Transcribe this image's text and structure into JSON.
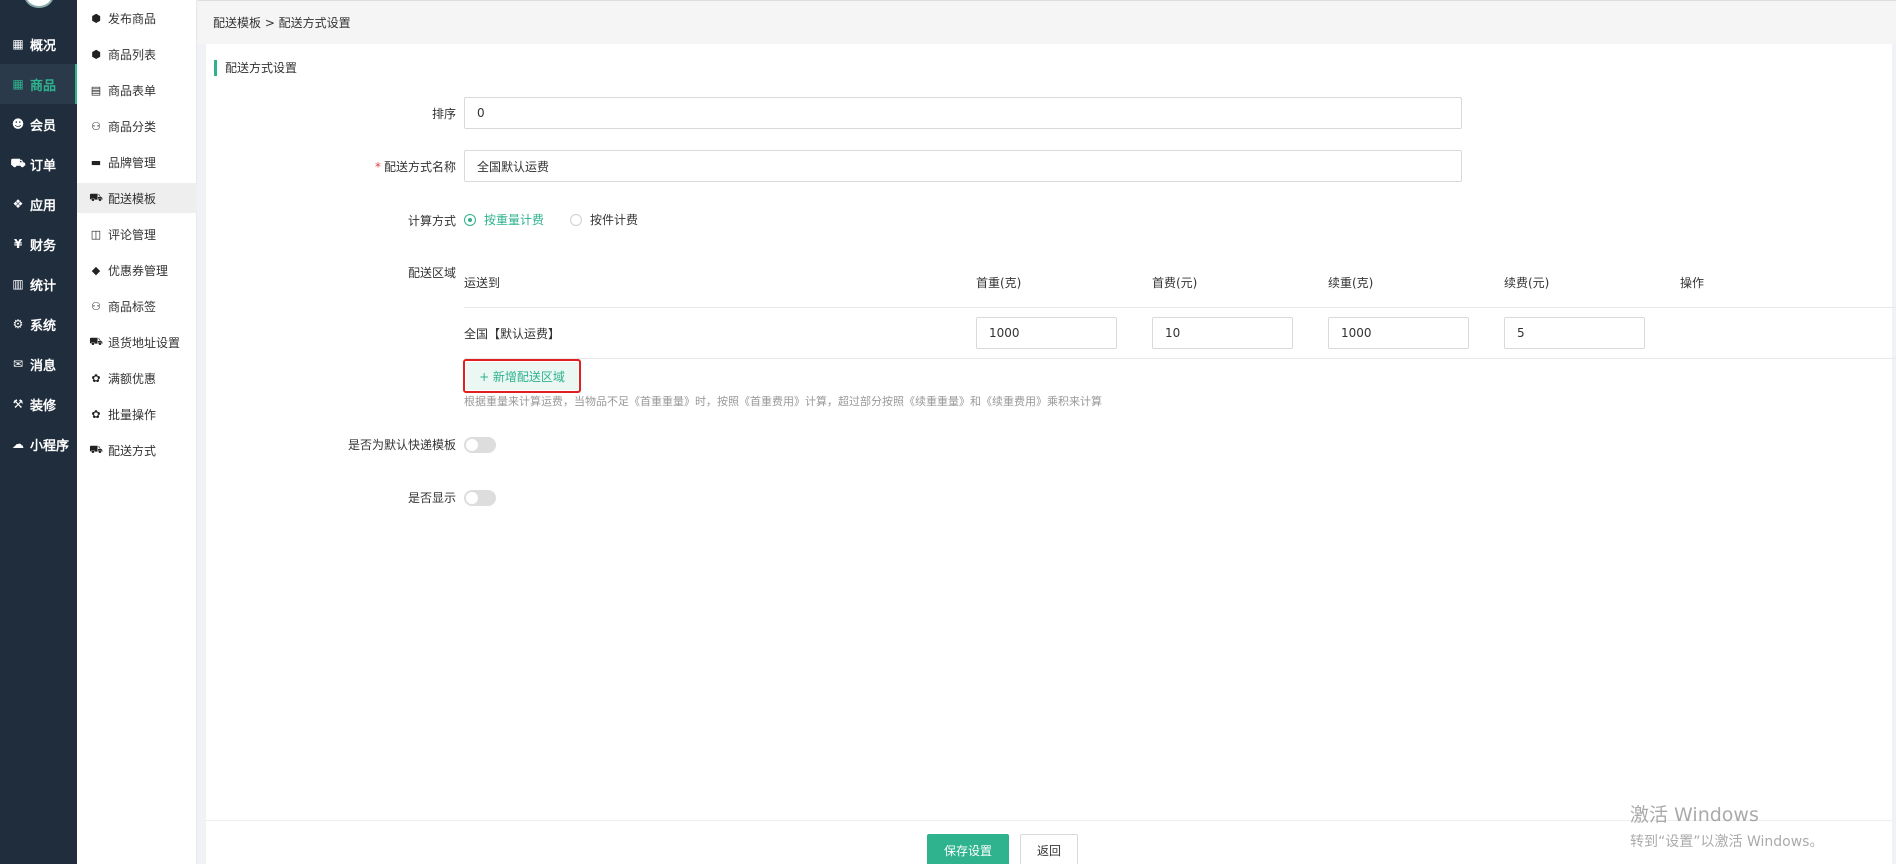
{
  "nav_primary": [
    {
      "label": "概况",
      "icon": "dashboard-icon",
      "glyph": "▦",
      "active": false
    },
    {
      "label": "商品",
      "icon": "goods-icon",
      "glyph": "▦",
      "active": true
    },
    {
      "label": "会员",
      "icon": "users-icon",
      "glyph": "☻",
      "active": false
    },
    {
      "label": "订单",
      "icon": "cart-icon",
      "glyph": "⛟",
      "active": false
    },
    {
      "label": "应用",
      "icon": "apps-icon",
      "glyph": "❖",
      "active": false
    },
    {
      "label": "财务",
      "icon": "yen-icon",
      "glyph": "¥",
      "active": false
    },
    {
      "label": "统计",
      "icon": "chart-icon",
      "glyph": "▥",
      "active": false
    },
    {
      "label": "系统",
      "icon": "gears-icon",
      "glyph": "⚙",
      "active": false
    },
    {
      "label": "消息",
      "icon": "chat-icon",
      "glyph": "✉",
      "active": false
    },
    {
      "label": "装修",
      "icon": "hammer-icon",
      "glyph": "⚒",
      "active": false
    },
    {
      "label": "小程序",
      "icon": "wechat-icon",
      "glyph": "☁",
      "active": false
    }
  ],
  "nav_secondary": [
    {
      "label": "发布商品",
      "icon": "cubes-icon",
      "glyph": "⬢",
      "active": false
    },
    {
      "label": "商品列表",
      "icon": "cubes-icon",
      "glyph": "⬢",
      "active": false
    },
    {
      "label": "商品表单",
      "icon": "file-icon",
      "glyph": "▤",
      "active": false
    },
    {
      "label": "商品分类",
      "icon": "sitemap-icon",
      "glyph": "⚇",
      "active": false
    },
    {
      "label": "品牌管理",
      "icon": "briefcase-icon",
      "glyph": "▬",
      "active": false
    },
    {
      "label": "配送模板",
      "icon": "truck-icon",
      "glyph": "⛟",
      "active": true
    },
    {
      "label": "评论管理",
      "icon": "columns-icon",
      "glyph": "◫",
      "active": false
    },
    {
      "label": "优惠券管理",
      "icon": "tags-icon",
      "glyph": "◆",
      "active": false
    },
    {
      "label": "商品标签",
      "icon": "sitemap-icon",
      "glyph": "⚇",
      "active": false
    },
    {
      "label": "退货地址设置",
      "icon": "truck-icon",
      "glyph": "⛟",
      "active": false
    },
    {
      "label": "满额优惠",
      "icon": "gift-icon",
      "glyph": "✿",
      "active": false
    },
    {
      "label": "批量操作",
      "icon": "gift-icon",
      "glyph": "✿",
      "active": false
    },
    {
      "label": "配送方式",
      "icon": "truck-icon",
      "glyph": "⛟",
      "active": false
    }
  ],
  "breadcrumb": "配送模板 > 配送方式设置",
  "section_title": "配送方式设置",
  "form": {
    "sort_label": "排序",
    "sort_value": "0",
    "name_required": "*",
    "name_label": "配送方式名称",
    "name_value": "全国默认运费",
    "calc_label": "计算方式",
    "calc_option_weight": "按重量计费",
    "calc_option_piece": "按件计费",
    "region_label": "配送区域",
    "table": {
      "headers": [
        "运送到",
        "首重(克)",
        "首费(元)",
        "续重(克)",
        "续费(元)",
        "操作"
      ],
      "row": {
        "region": "全国【默认运费】",
        "first_weight": "1000",
        "first_fee": "10",
        "extra_weight": "1000",
        "extra_fee": "5"
      }
    },
    "add_region_label": "+ 新增配送区域",
    "hint": "根据重量来计算运费，当物品不足《首重重量》时，按照《首重费用》计算，超过部分按照《续重重量》和《续重费用》乘积来计算",
    "default_template_label": "是否为默认快递模板",
    "show_label": "是否显示"
  },
  "footer": {
    "save_label": "保存设置",
    "back_label": "返回"
  },
  "watermark": {
    "line1": "激活 Windows",
    "line2": "转到“设置”以激活 Windows。"
  },
  "colors": {
    "accent": "#2fb28e",
    "nav_bg": "#1f2d3d",
    "highlight_border": "#e02020"
  }
}
